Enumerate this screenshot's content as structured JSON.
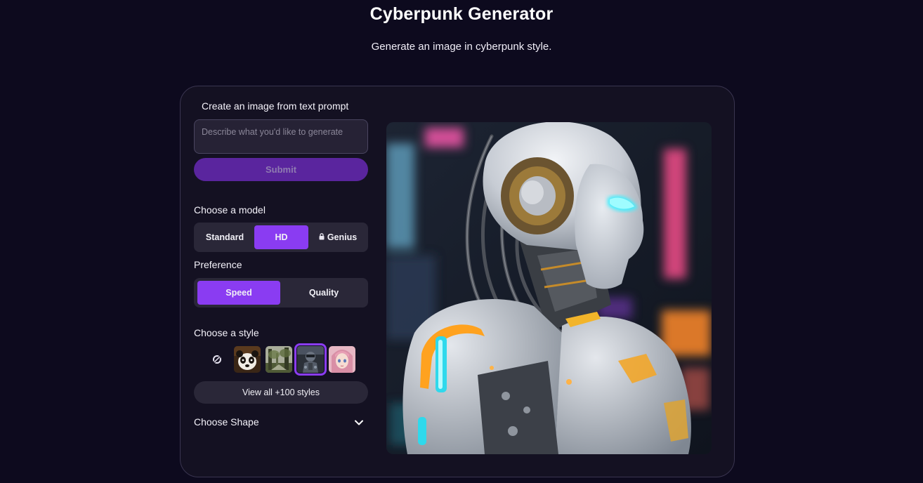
{
  "header": {
    "title": "Cyberpunk Generator",
    "subtitle": "Generate an image in cyberpunk style."
  },
  "prompt": {
    "label": "Create an image from text prompt",
    "placeholder": "Describe what you'd like to generate",
    "value": "",
    "submit_label": "Submit"
  },
  "model": {
    "label": "Choose a model",
    "options": [
      {
        "label": "Standard",
        "selected": false,
        "locked": false
      },
      {
        "label": "HD",
        "selected": true,
        "locked": false
      },
      {
        "label": "Genius",
        "selected": false,
        "locked": true,
        "icon": "lock-icon"
      }
    ]
  },
  "preference": {
    "label": "Preference",
    "options": [
      {
        "label": "Speed",
        "selected": true
      },
      {
        "label": "Quality",
        "selected": false
      }
    ]
  },
  "style": {
    "label": "Choose a style",
    "options": [
      {
        "icon": "no-style-icon",
        "selected": false
      },
      {
        "icon": "panda-thumbnail",
        "selected": false
      },
      {
        "icon": "forest-thumbnail",
        "selected": false
      },
      {
        "icon": "cyber-robot-thumbnail",
        "selected": true
      },
      {
        "icon": "anime-girl-thumbnail",
        "selected": false
      }
    ],
    "view_all_label": "View all +100 styles"
  },
  "shape": {
    "label": "Choose Shape",
    "expanded": false,
    "icon": "chevron-down-icon"
  },
  "preview": {
    "icon": "cyberpunk-robot-image"
  },
  "colors": {
    "accent": "#8a3cf2",
    "submit": "#5a259e",
    "background": "#0d0a1e",
    "card": "#141122"
  }
}
